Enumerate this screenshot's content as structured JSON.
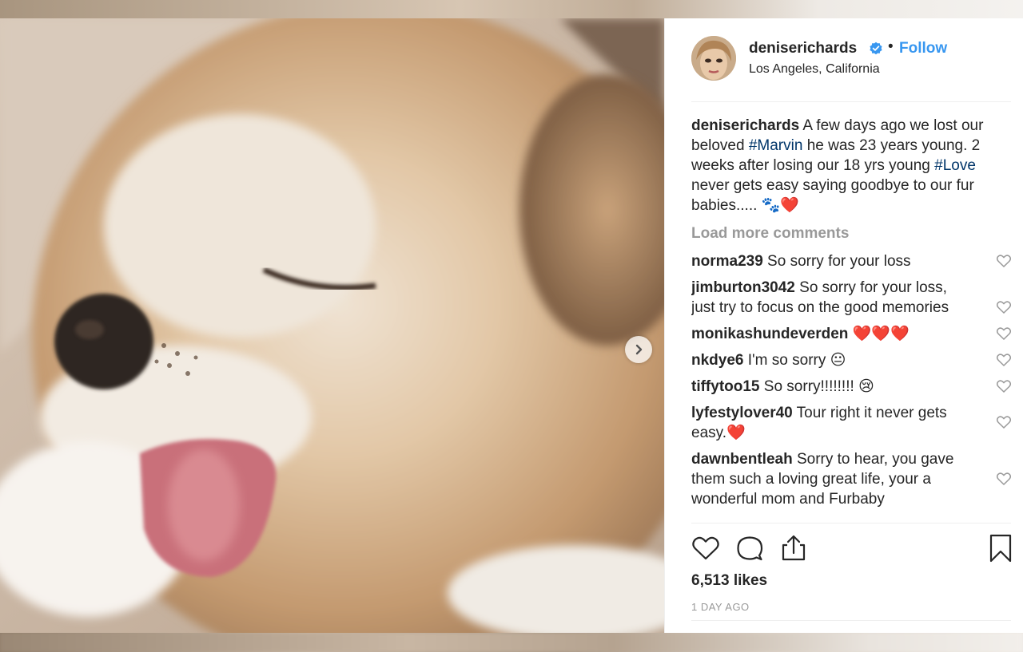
{
  "post": {
    "username": "deniserichards",
    "follow_label": "Follow",
    "separator": "•",
    "location": "Los Angeles, California",
    "caption": {
      "username": "deniserichards",
      "text_1": " A few days ago we lost our beloved ",
      "tag_1": "#Marvin",
      "text_2": " he was 23 years young. 2 weeks after losing our 18 yrs young ",
      "tag_2": "#Love",
      "text_3": " never gets easy saying goodbye to our fur babies..... 🐾❤️"
    },
    "load_more_label": "Load more comments",
    "comments": [
      {
        "user": "norma239",
        "text": " So sorry for your loss"
      },
      {
        "user": "jimburton3042",
        "text": " So sorry for your loss, just try to focus on the good memories"
      },
      {
        "user": "monikashundeverden",
        "text": " ❤️❤️❤️"
      },
      {
        "user": "nkdye6",
        "text": " I'm so sorry 😐"
      },
      {
        "user": "tiffytoo15",
        "text": " So sorry!!!!!!!! 😢"
      },
      {
        "user": "lyfestylover40",
        "text": " Tour right it never gets easy.❤️"
      },
      {
        "user": "dawnbentleah",
        "text": " Sorry to hear, you gave them such a loving great life, your a wonderful mom and Furbaby"
      }
    ],
    "likes": "6,513 likes",
    "timestamp": "1 DAY AGO"
  },
  "icons": {
    "like": "heart-icon",
    "comment": "comment-bubble-icon",
    "share": "share-icon",
    "save": "bookmark-icon",
    "next": "chevron-right-icon",
    "verified": "verified-badge-icon"
  },
  "colors": {
    "link_blue": "#3897f0",
    "hashtag": "#003569",
    "muted": "#999999",
    "text": "#262626"
  }
}
